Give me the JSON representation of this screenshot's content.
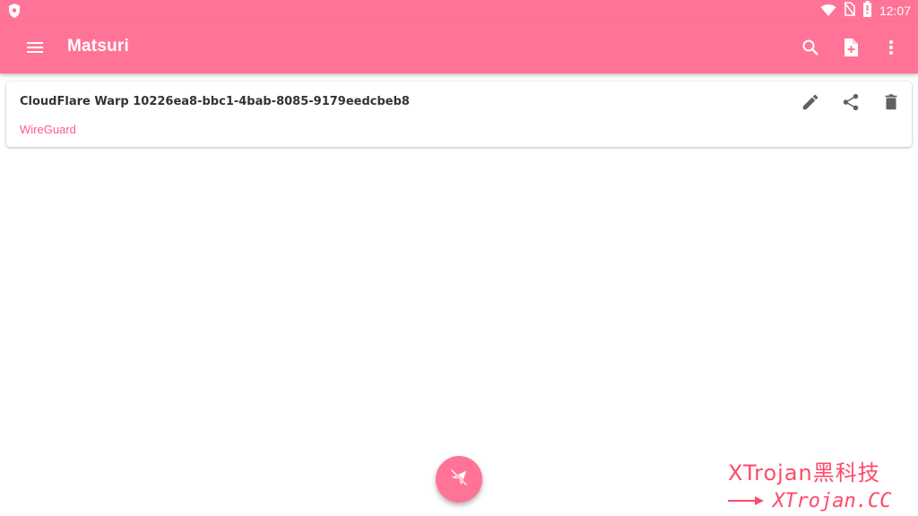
{
  "status_bar": {
    "time": "12:07",
    "icons": [
      "shield-icon",
      "wifi-icon",
      "no-sim-icon",
      "battery-icon"
    ]
  },
  "toolbar": {
    "title": "Matsuri",
    "icons": [
      "menu-icon",
      "search-icon",
      "add-file-icon",
      "more-vert-icon"
    ]
  },
  "profile": {
    "name": "CloudFlare Warp 10226ea8-bbc1-4bab-8085-9179eedcbeb8",
    "type": "WireGuard",
    "actions": [
      "edit-icon",
      "share-icon",
      "delete-icon"
    ]
  },
  "fab": {
    "icon": "paper-plane-off-icon"
  },
  "watermark": {
    "line1": "XTrojan黑科技",
    "line2": "XTrojan.CC",
    "arrow": "arrow-icon"
  },
  "colors": {
    "accent": "#ff7496",
    "accent_text": "#ff5a86",
    "icon_gray": "#616161",
    "watermark": "#ff4a6a"
  }
}
